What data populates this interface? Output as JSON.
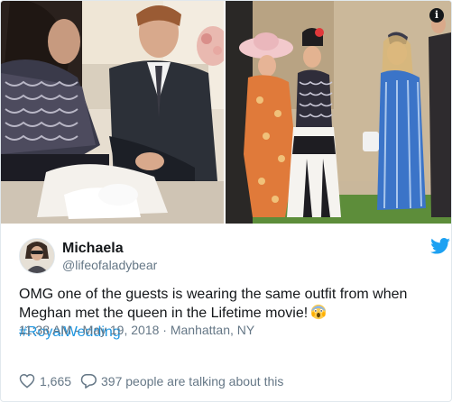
{
  "tweet": {
    "author_name": "Michaela",
    "author_handle": "@lifeofaladybear",
    "text_line1": "OMG one of the guests is wearing the same outfit from when",
    "text_line2": "Meghan met the queen in the Lifetime movie!",
    "hashtag": "#RoyalWedding",
    "timestamp": "11:38 AM - May 19, 2018 · Manhattan, NY",
    "likes": "1,665",
    "talking": "397 people are talking about this"
  },
  "icons": {
    "info": "info-icon",
    "bird": "twitter-bird-icon",
    "heart": "heart-icon",
    "reply": "speech-bubble-icon",
    "emoji": "face-screaming-emoji"
  },
  "colors": {
    "link": "#1b95e0",
    "text": "#14171a",
    "muted": "#657786",
    "brand": "#1da1f2"
  }
}
